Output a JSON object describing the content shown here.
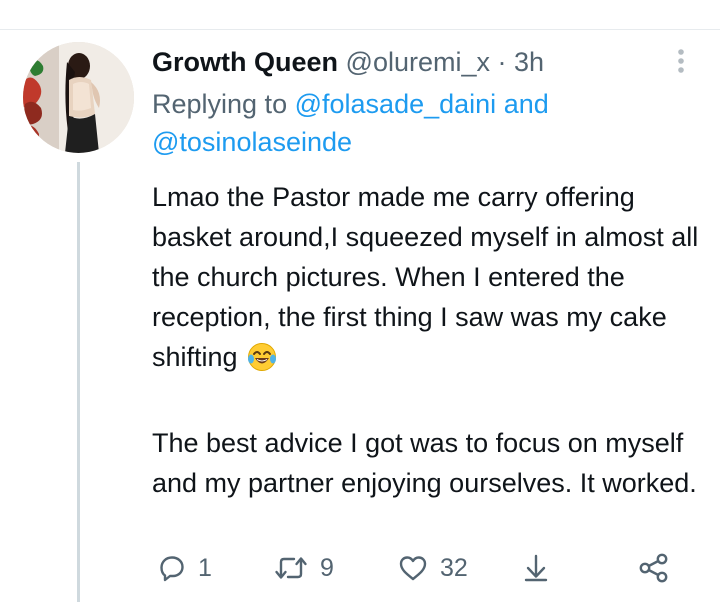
{
  "tweet": {
    "display_name": "Growth Queen",
    "handle": "@oluremi_x",
    "separator": "·",
    "time": "3h",
    "replying_prefix": "Replying to",
    "mention_1": "@folasade_daini",
    "and_word": "and",
    "mention_2": "@tosinolaseinde",
    "text_part_1": "Lmao the Pastor made me carry offering basket around,I squeezed myself in almost all the church pictures. When I entered the reception, the first thing I saw was my cake shifting",
    "text_part_2": "The best advice I got was to focus on myself and my partner enjoying ourselves. It worked.",
    "emoji_name": "face-with-tears-of-joy"
  },
  "actions": {
    "reply_icon": "reply-icon",
    "reply_count": "1",
    "retweet_icon": "retweet-icon",
    "retweet_count": "9",
    "like_icon": "heart-icon",
    "like_count": "32",
    "download_icon": "download-icon",
    "share_icon": "share-icon"
  },
  "colors": {
    "accent": "#1d9bf0",
    "text": "#0f1419",
    "secondary": "#536471",
    "thread_line": "#cfd9de",
    "divider": "#e7ebee"
  }
}
